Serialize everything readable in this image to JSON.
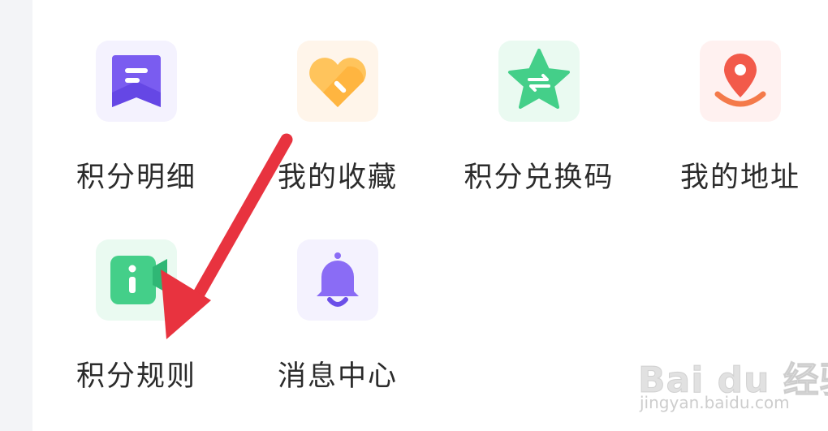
{
  "grid": {
    "items": [
      {
        "label": "积分明细",
        "icon": "points-detail-icon",
        "tint": "#f4f2fe",
        "accent": "#7a5cf0"
      },
      {
        "label": "我的收藏",
        "icon": "heart-icon",
        "tint": "#fff5ea",
        "accent": "#ffb84a"
      },
      {
        "label": "积分兑换码",
        "icon": "star-exchange-icon",
        "tint": "#eafaf1",
        "accent": "#44cf89"
      },
      {
        "label": "我的地址",
        "icon": "location-pin-icon",
        "tint": "#fff1f0",
        "accent": "#f25a4a"
      },
      {
        "label": "积分规则",
        "icon": "info-flag-icon",
        "tint": "#eafaf1",
        "accent": "#44cf89"
      },
      {
        "label": "消息中心",
        "icon": "bell-icon",
        "tint": "#f4f2fe",
        "accent": "#8a6cf5"
      }
    ]
  },
  "annotation": {
    "arrow_color": "#e8333f",
    "points_to": "积分规则"
  },
  "watermark": {
    "logo_text": "Bai du 经验",
    "url_text": "jingyan.baidu.com"
  }
}
